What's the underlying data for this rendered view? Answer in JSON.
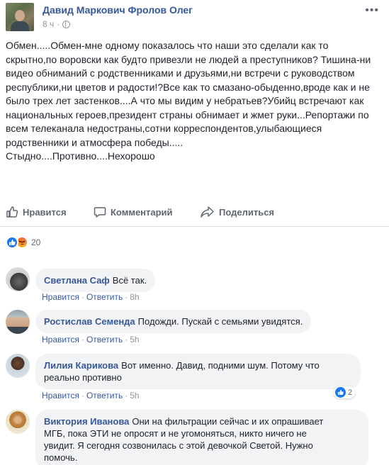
{
  "post": {
    "author": "Давид Маркович Фролов Олег",
    "time": "8 ч",
    "paragraph": "Обмен.....Обмен-мне одному показалось что наши это сделали как то скрытно,по воровски как будто привезли не людей а преступников? Тишина-ни видео обниманий с родственниками и друзьями,ни встречи с руководством республики,ни цветов и радости!?Все как то смазано-обыденно,вроде как и не было трех лет застенков....А что мы видим у небратьев?Убийц встречают как национальных героев,президент страны обнимает и жмет руки...Репортажи по всем телеканала недостраны,сотни корреспондентов,улыбающиеся родственники и атмосфера победы.....",
    "closing_line": "Стыдно....Противно....Нехорошо"
  },
  "actions": {
    "like_label": "Нравится",
    "comment_label": "Комментарий",
    "share_label": "Поделиться"
  },
  "reactions": {
    "count": "20",
    "types": [
      "like-icon",
      "angry-icon"
    ]
  },
  "comments": [
    {
      "name": "Светлана Саф",
      "text": "Всё так.",
      "like_label": "Нравится",
      "reply_label": "Ответить",
      "time": "8h"
    },
    {
      "name": "Ростислав Семенда",
      "text": "Подожди. Пускай с семьями увидятся.",
      "like_label": "Нравится",
      "reply_label": "Ответить",
      "time": "5h"
    },
    {
      "name": "Лилия Карикова",
      "text_line1": "Вот именно. Давид, подними шум. Потому что",
      "text_line2": "реально противно",
      "like_label": "Нравится",
      "reply_label": "Ответить",
      "time": "5h",
      "likes": "2"
    },
    {
      "name": "Виктория Иванова",
      "text_line1": "Они на фильтрации сейчас и их опрашивает",
      "text_line2": "МГБ, пока ЭТИ не опросят и не угомоняться, никто ничего не",
      "text_line3": "увидит. Я сегодня созвонилась с этой девочкой Светой. Нужно",
      "text_line4": "помочь."
    }
  ],
  "colors": {
    "link": "#385898",
    "meta": "#90949c",
    "bubble": "#f2f3f5",
    "like_blue": "#1877f2"
  }
}
